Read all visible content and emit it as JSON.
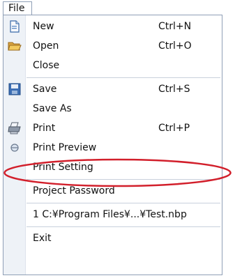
{
  "menubar": {
    "file_label": "File"
  },
  "menu": {
    "items": [
      {
        "label": "New",
        "shortcut": "Ctrl+N",
        "icon": "new-document-icon"
      },
      {
        "label": "Open",
        "shortcut": "Ctrl+O",
        "icon": "open-folder-icon"
      },
      {
        "label": "Close",
        "shortcut": ""
      },
      {
        "label": "Save",
        "shortcut": "Ctrl+S",
        "icon": "save-disk-icon"
      },
      {
        "label": "Save As",
        "shortcut": ""
      },
      {
        "label": "Print",
        "shortcut": "Ctrl+P",
        "icon": "printer-icon"
      },
      {
        "label": "Print Preview",
        "shortcut": "",
        "icon": "print-preview-icon",
        "highlighted": true
      },
      {
        "label": "Print Setting",
        "shortcut": ""
      },
      {
        "label": "Project Password",
        "shortcut": ""
      },
      {
        "label": "1 C:¥Program Files¥...¥Test.nbp",
        "shortcut": ""
      },
      {
        "label": "Exit",
        "shortcut": ""
      }
    ]
  },
  "colors": {
    "menu_border": "#8f9fb6",
    "gutter": "#eef2f7",
    "highlight_ellipse": "#d21f2b"
  }
}
